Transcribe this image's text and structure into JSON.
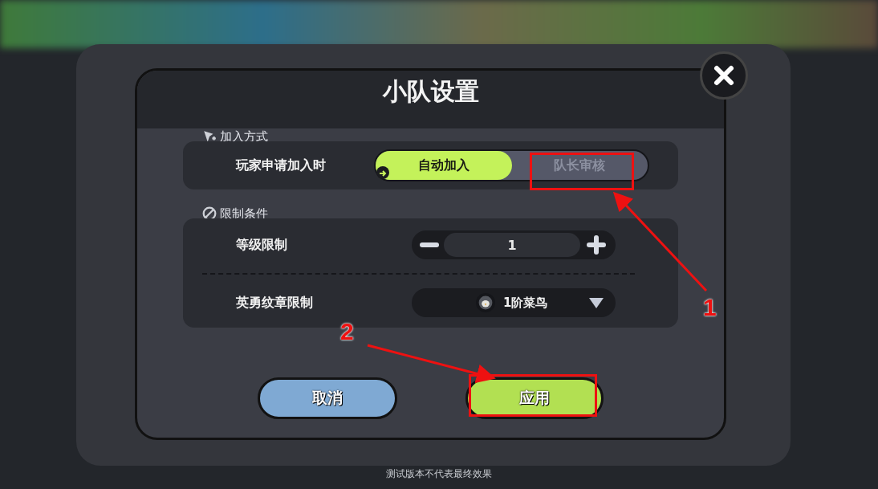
{
  "dialog": {
    "title": "小队设置"
  },
  "join_method": {
    "label": "加入方式",
    "row_label": "玩家申请加入时",
    "options": [
      {
        "label": "自动加入",
        "selected": true
      },
      {
        "label": "队长审核",
        "selected": false
      }
    ]
  },
  "restrictions": {
    "label": "限制条件",
    "level": {
      "label": "等级限制",
      "value": "1"
    },
    "badge": {
      "label": "英勇纹章限制",
      "value": "1阶菜鸟"
    }
  },
  "buttons": [
    {
      "label": "取消",
      "kind": "cancel"
    },
    {
      "label": "应用",
      "kind": "apply"
    }
  ],
  "footer_note": "测试版本不代表最终效果",
  "annotations": [
    {
      "number": "1"
    },
    {
      "number": "2"
    }
  ]
}
